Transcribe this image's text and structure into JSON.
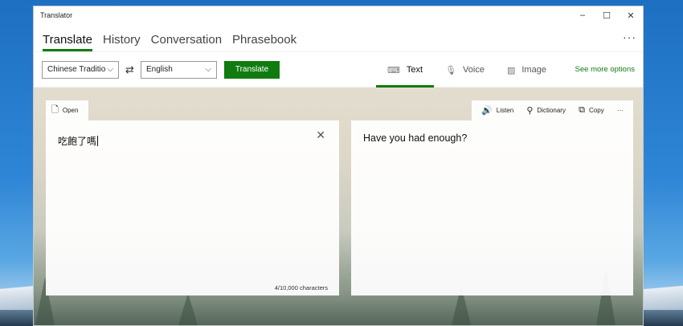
{
  "window": {
    "title": "Translator",
    "controls": {
      "minimize": "–",
      "maximize": "☐",
      "close": "✕"
    }
  },
  "nav": {
    "tabs": [
      {
        "label": "Translate",
        "active": true
      },
      {
        "label": "History",
        "active": false
      },
      {
        "label": "Conversation",
        "active": false
      },
      {
        "label": "Phrasebook",
        "active": false
      }
    ],
    "more": "···"
  },
  "toolbar": {
    "source_language": "Chinese Traditio",
    "target_language": "English",
    "translate_label": "Translate",
    "modes": [
      {
        "label": "Text",
        "icon": "keyboard-icon",
        "active": true
      },
      {
        "label": "Voice",
        "icon": "microphone-icon",
        "active": false
      },
      {
        "label": "Image",
        "icon": "image-icon",
        "active": false
      }
    ],
    "see_more": "See more options"
  },
  "source": {
    "open_label": "Open",
    "text": "吃飽了嗎",
    "char_count": "4/10,000 characters"
  },
  "output": {
    "listen_label": "Listen",
    "dictionary_label": "Dictionary",
    "copy_label": "Copy",
    "more": "···",
    "text": "Have you had enough?"
  },
  "colors": {
    "accent": "#107c10",
    "window_bg": "#f2f2f2"
  }
}
